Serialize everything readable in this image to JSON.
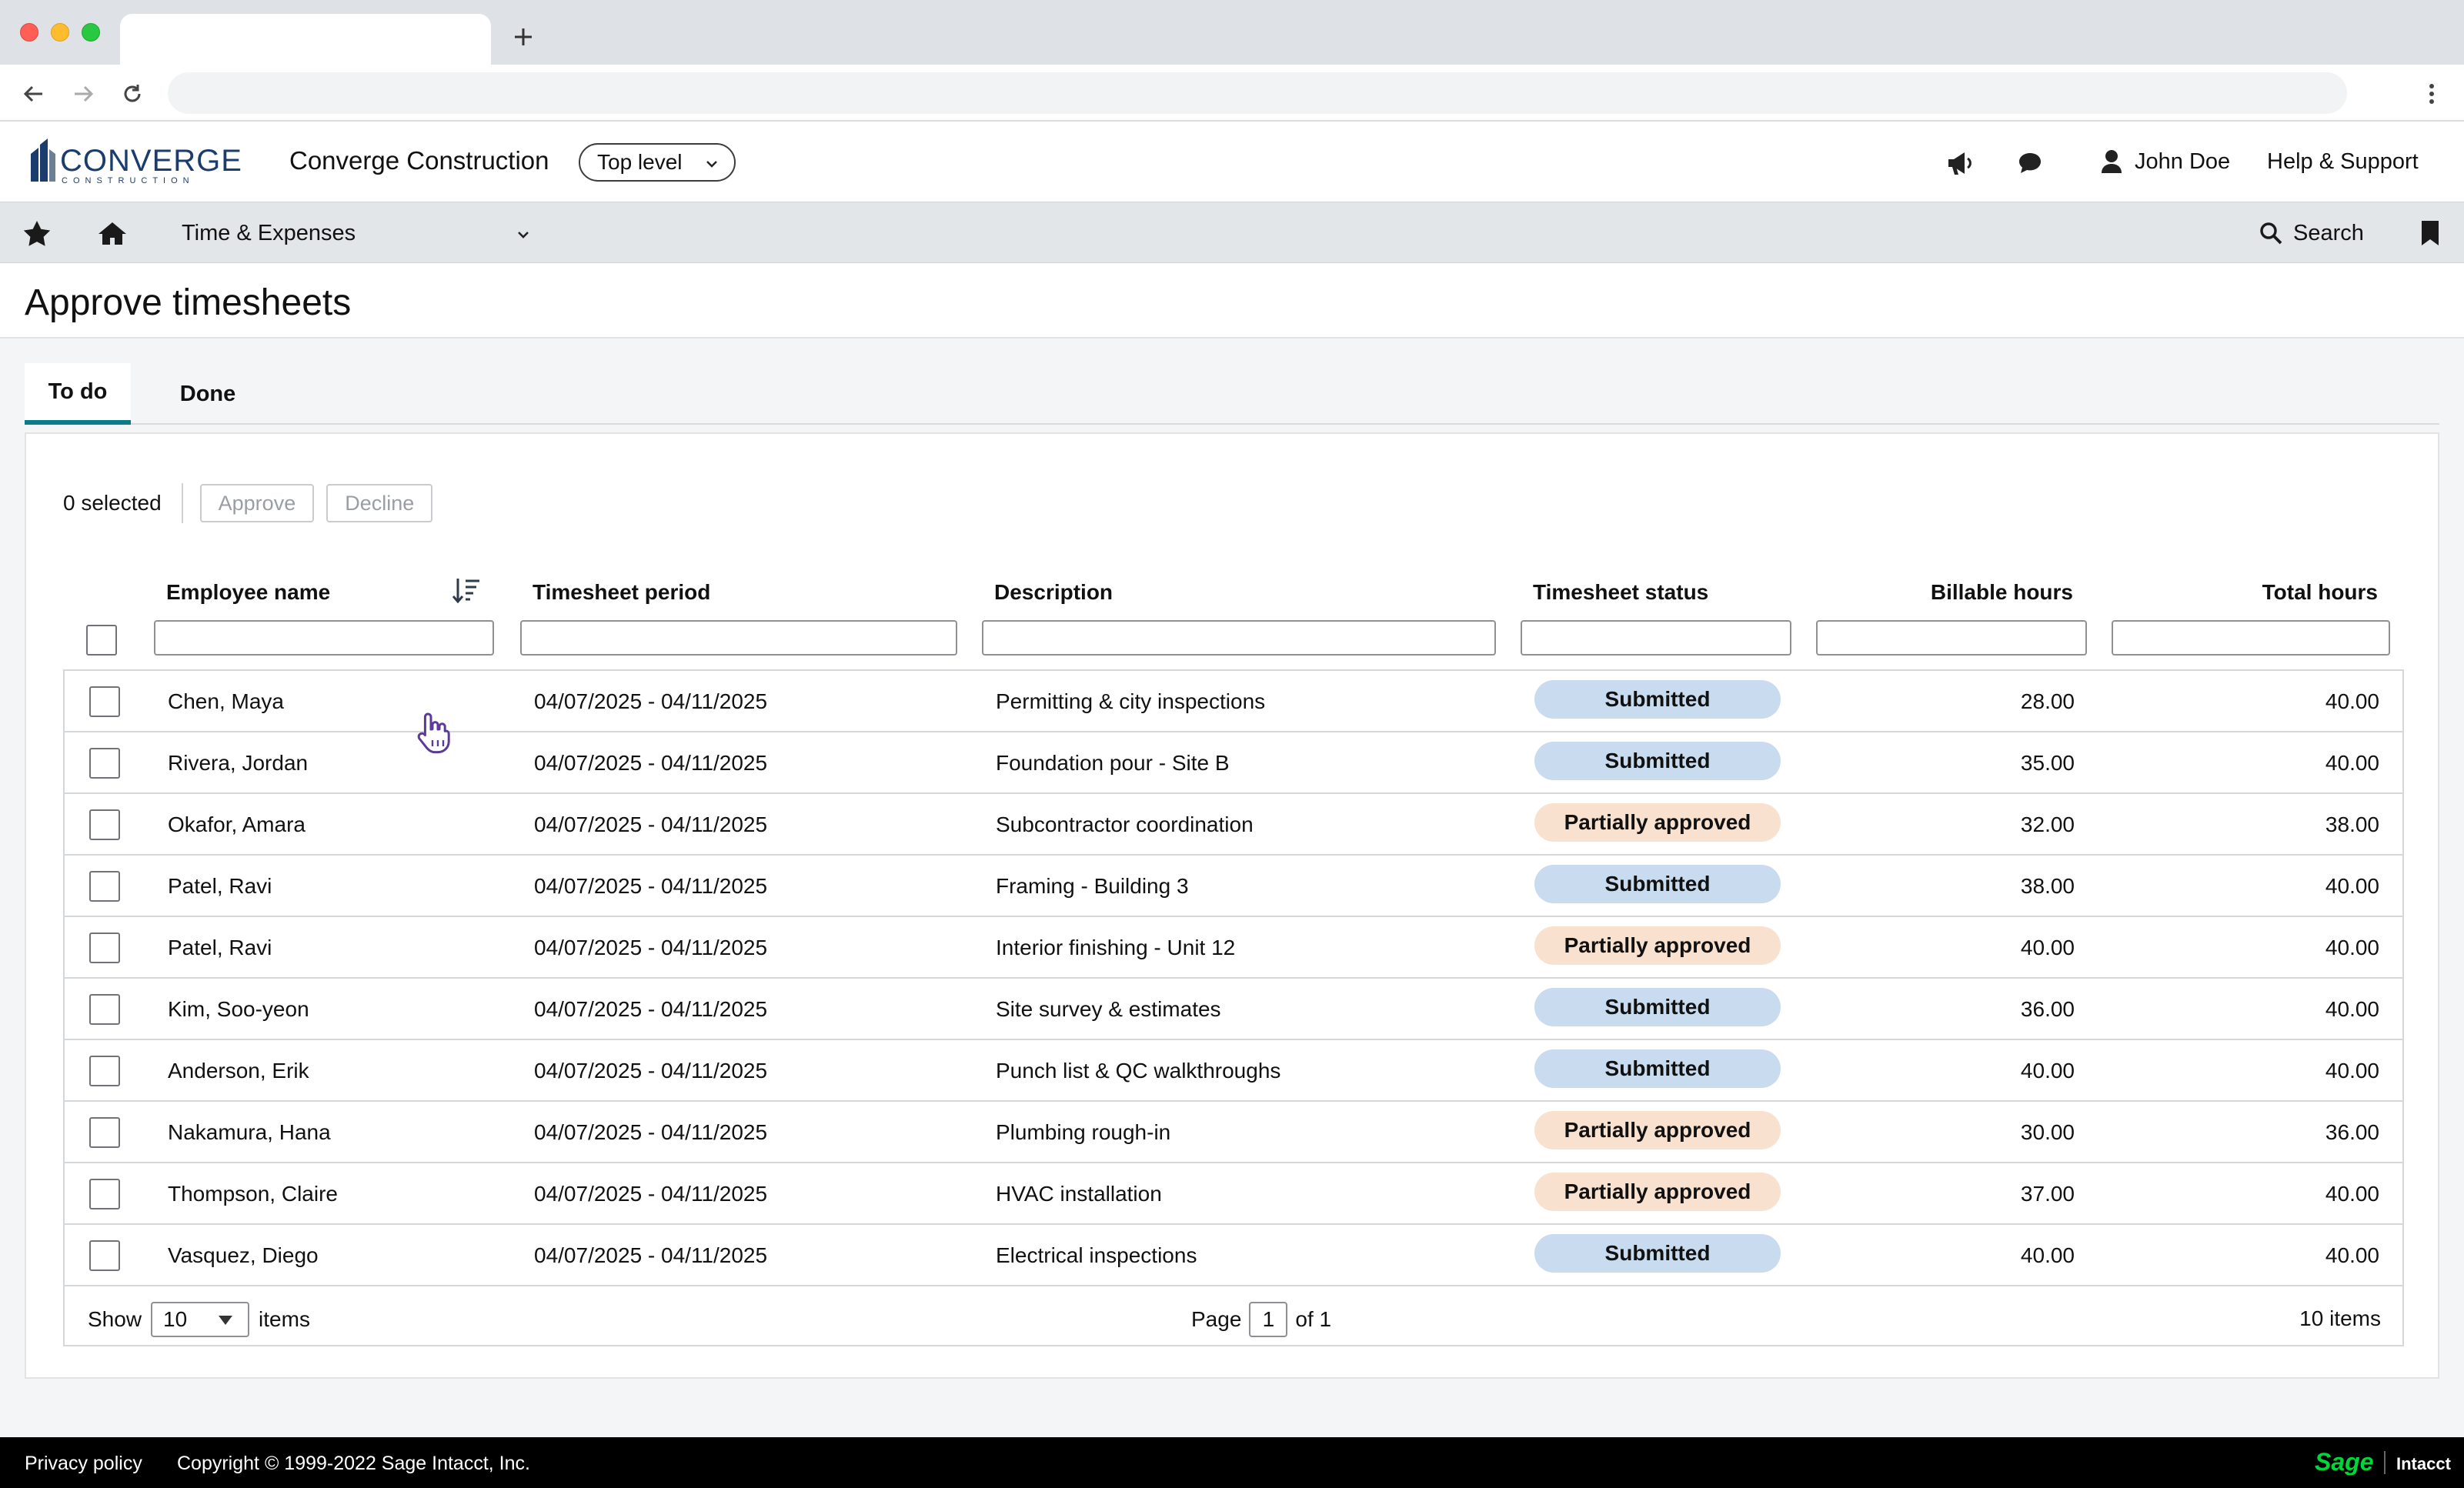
{
  "app": {
    "company_name": "Converge Construction",
    "level": "Top level",
    "user_name": "John Doe",
    "help": "Help & Support",
    "module": "Time & Expenses",
    "search": "Search",
    "logo_text": "CONVERGE",
    "logo_sub": "CONSTRUCTION"
  },
  "page": {
    "title": "Approve timesheets",
    "tabs": [
      "To do",
      "Done"
    ],
    "active_tab": "To do"
  },
  "actions": {
    "selected_text": "0 selected",
    "approve": "Approve",
    "decline": "Decline"
  },
  "table": {
    "headers": {
      "employee": "Employee name",
      "period": "Timesheet period",
      "description": "Description",
      "status": "Timesheet status",
      "billable": "Billable hours",
      "total": "Total hours"
    },
    "rows": [
      {
        "employee": "Chen, Maya",
        "period": "04/07/2025 - 04/11/2025",
        "description": "Permitting & city inspections",
        "status": "Submitted",
        "billable": "28.00",
        "total": "40.00"
      },
      {
        "employee": "Rivera, Jordan",
        "period": "04/07/2025 - 04/11/2025",
        "description": "Foundation pour - Site B",
        "status": "Submitted",
        "billable": "35.00",
        "total": "40.00"
      },
      {
        "employee": "Okafor, Amara",
        "period": "04/07/2025 - 04/11/2025",
        "description": "Subcontractor coordination",
        "status": "Partially approved",
        "billable": "32.00",
        "total": "38.00"
      },
      {
        "employee": "Patel, Ravi",
        "period": "04/07/2025 - 04/11/2025",
        "description": "Framing - Building 3",
        "status": "Submitted",
        "billable": "38.00",
        "total": "40.00"
      },
      {
        "employee": "Patel, Ravi",
        "period": "04/07/2025 - 04/11/2025",
        "description": "Interior finishing - Unit 12",
        "status": "Partially approved",
        "billable": "40.00",
        "total": "40.00"
      },
      {
        "employee": "Kim, Soo-yeon",
        "period": "04/07/2025 - 04/11/2025",
        "description": "Site survey & estimates",
        "status": "Submitted",
        "billable": "36.00",
        "total": "40.00"
      },
      {
        "employee": "Anderson, Erik",
        "period": "04/07/2025 - 04/11/2025",
        "description": "Punch list & QC walkthroughs",
        "status": "Submitted",
        "billable": "40.00",
        "total": "40.00"
      },
      {
        "employee": "Nakamura, Hana",
        "period": "04/07/2025 - 04/11/2025",
        "description": "Plumbing rough-in",
        "status": "Partially approved",
        "billable": "30.00",
        "total": "36.00"
      },
      {
        "employee": "Thompson, Claire",
        "period": "04/07/2025 - 04/11/2025",
        "description": "HVAC installation",
        "status": "Partially approved",
        "billable": "37.00",
        "total": "40.00"
      },
      {
        "employee": "Vasquez, Diego",
        "period": "04/07/2025 - 04/11/2025",
        "description": "Electrical inspections",
        "status": "Submitted",
        "billable": "40.00",
        "total": "40.00"
      }
    ],
    "footer": {
      "show_label": "Show",
      "page_size": "10",
      "items_label": "items",
      "page_label": "Page",
      "page_number": "1",
      "of_label": "of 1",
      "count": "10 items"
    }
  },
  "status_colors": {
    "Submitted": "#c9dcef",
    "Partially approved": "#f8e2cf"
  },
  "footer": {
    "privacy": "Privacy policy",
    "copyright": "Copyright © 1999-2022 Sage Intacct, Inc.",
    "brand": "Sage",
    "brand_product": "Intacct"
  }
}
